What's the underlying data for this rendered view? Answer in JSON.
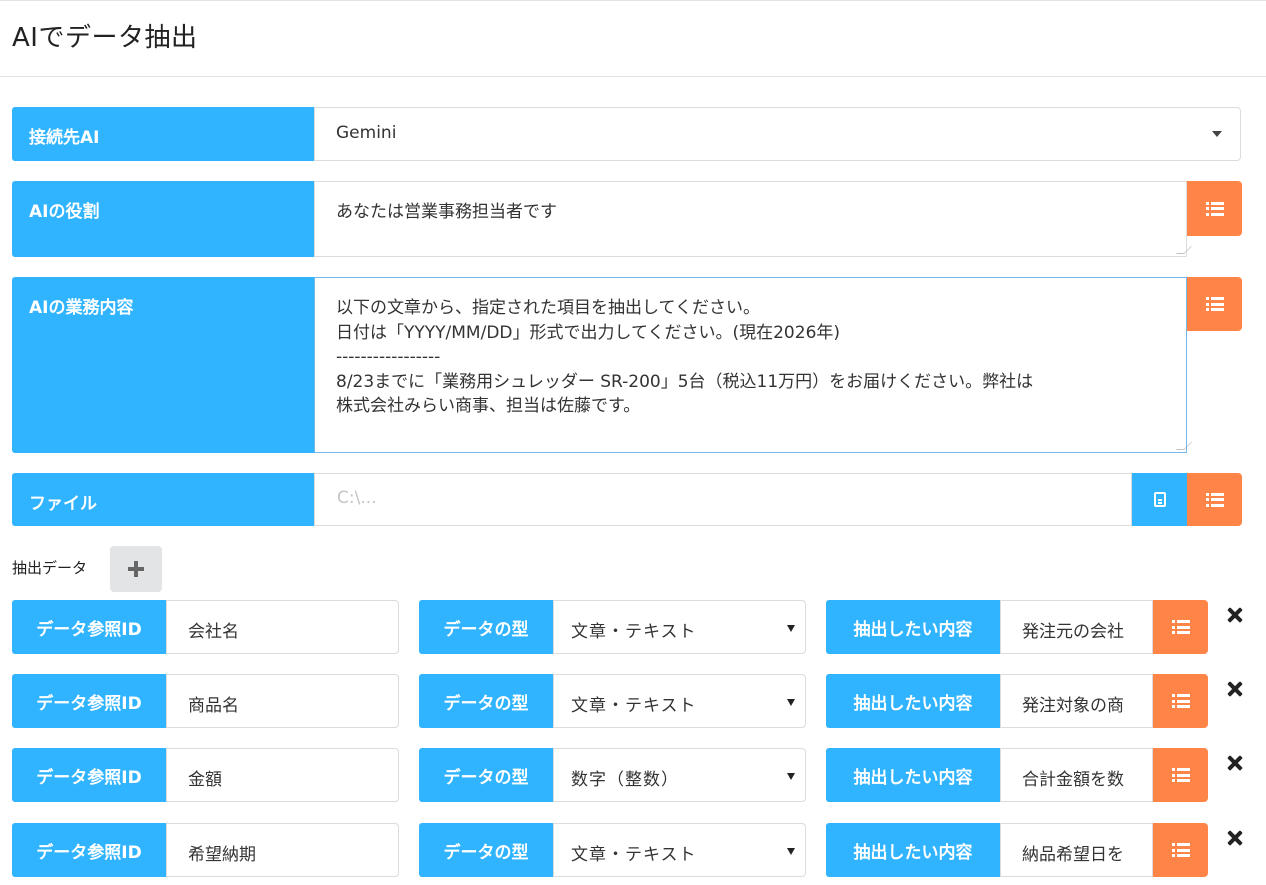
{
  "page": {
    "title": "AIでデータ抽出"
  },
  "form": {
    "ai_label": "接続先AI",
    "ai_value": "Gemini",
    "role_label": "AIの役割",
    "role_value": "あなたは営業事務担当者です",
    "task_label": "AIの業務内容",
    "task_value": "以下の文章から、指定された項目を抽出してください。\n日付は「YYYY/MM/DD」形式で出力してください。(現在2026年)\n-----------------\n8/23までに「業務用シュレッダー SR-200」5台（税込11万円）をお届けください。弊社は\n株式会社みらい商事、担当は佐藤です。",
    "file_label": "ファイル",
    "file_placeholder": "C:\\..."
  },
  "extract": {
    "section_label": "抽出データ",
    "id_label": "データ参照ID",
    "type_label": "データの型",
    "content_label": "抽出したい内容",
    "rows": [
      {
        "id": "会社名",
        "type": "文章・テキスト",
        "content": "発注元の会社"
      },
      {
        "id": "商品名",
        "type": "文章・テキスト",
        "content": "発注対象の商"
      },
      {
        "id": "金額",
        "type": "数字（整数）",
        "content": "合計金額を数"
      },
      {
        "id": "希望納期",
        "type": "文章・テキスト",
        "content": "納品希望日を"
      }
    ]
  },
  "colors": {
    "label_blue": "#31b4ff",
    "button_orange": "#ff8447",
    "add_button_gray": "#e3e4e6"
  },
  "icons": {
    "list": "list-icon",
    "file": "file-icon",
    "add": "plus-icon",
    "remove": "close-icon",
    "dropdown": "chevron-down-icon"
  }
}
